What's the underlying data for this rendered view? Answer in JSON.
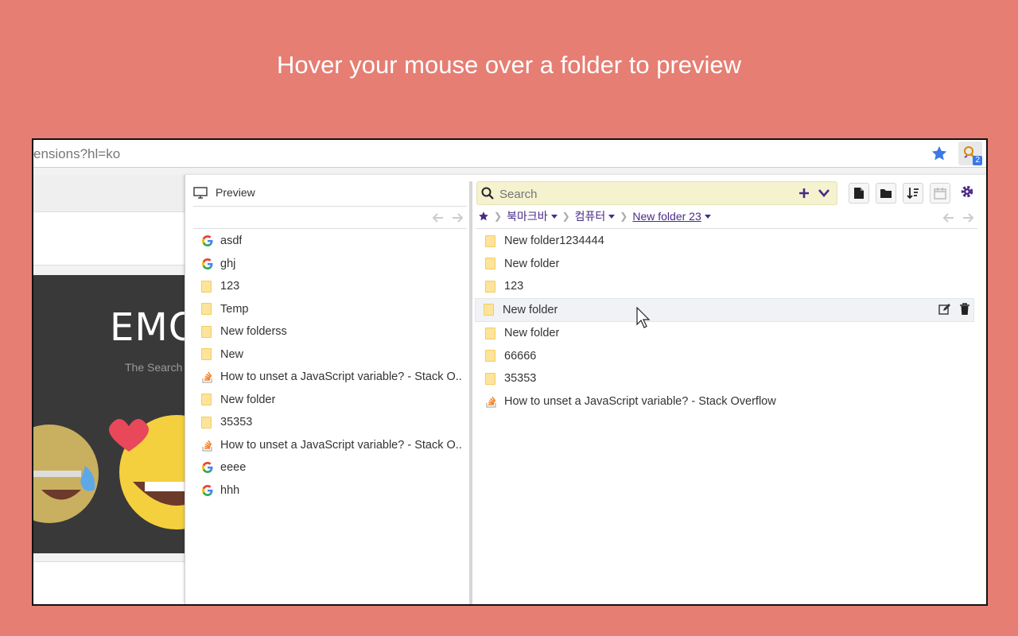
{
  "headline": "Hover your mouse over a folder to preview",
  "browser": {
    "url_text": "ensions?hl=ko",
    "extension_badge": "2"
  },
  "background_page": {
    "hero_title": "EMO",
    "hero_subtitle": "The Search"
  },
  "preview": {
    "title": "Preview",
    "items": [
      {
        "type": "google",
        "label": "asdf"
      },
      {
        "type": "google",
        "label": "ghj"
      },
      {
        "type": "folder",
        "label": "123"
      },
      {
        "type": "folder",
        "label": "Temp"
      },
      {
        "type": "folder",
        "label": "New folderss"
      },
      {
        "type": "folder",
        "label": "New"
      },
      {
        "type": "stackoverflow",
        "label": "How to unset a JavaScript variable? - Stack O.."
      },
      {
        "type": "folder",
        "label": "New folder"
      },
      {
        "type": "folder",
        "label": "35353"
      },
      {
        "type": "stackoverflow",
        "label": "How to unset a JavaScript variable? - Stack O.."
      },
      {
        "type": "google",
        "label": "eeee"
      },
      {
        "type": "google",
        "label": "hhh"
      }
    ]
  },
  "main": {
    "search_placeholder": "Search",
    "breadcrumb": [
      "북마크바",
      "컴퓨터",
      "New folder 23"
    ],
    "items": [
      {
        "type": "folder",
        "label": "New folder1234444"
      },
      {
        "type": "folder",
        "label": "New folder"
      },
      {
        "type": "folder",
        "label": "123"
      },
      {
        "type": "folder",
        "label": "New folder",
        "hovered": true
      },
      {
        "type": "folder",
        "label": "New folder"
      },
      {
        "type": "folder",
        "label": "66666"
      },
      {
        "type": "folder",
        "label": "35353"
      },
      {
        "type": "stackoverflow",
        "label": "How to unset a JavaScript variable? - Stack Overflow"
      }
    ]
  },
  "colors": {
    "background": "#e67e73",
    "accent_purple": "#4a2b86",
    "folder_yellow": "#fde49a",
    "search_bg": "#f4f2cf",
    "star_blue": "#3b78e7"
  }
}
